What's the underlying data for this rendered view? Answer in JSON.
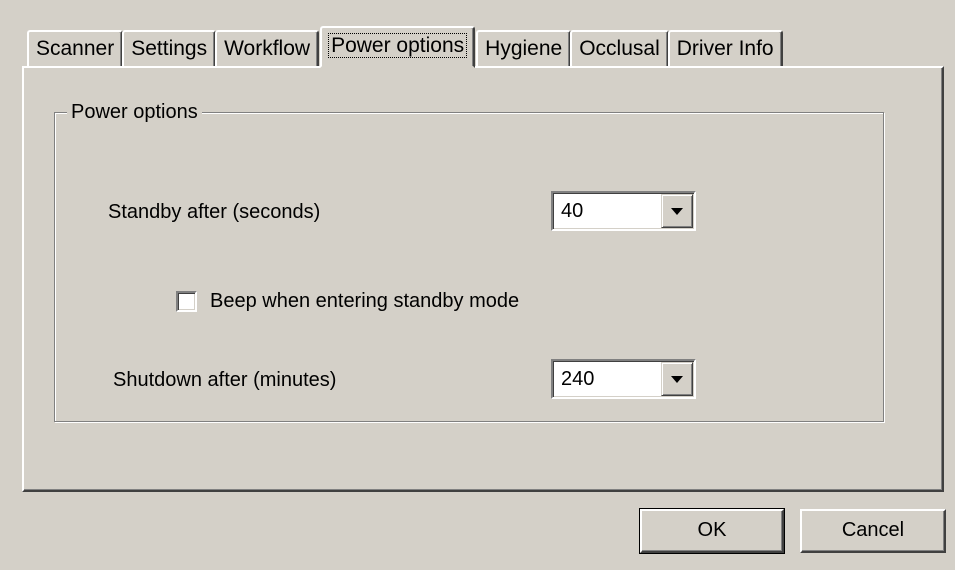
{
  "tabs": [
    {
      "label": "Scanner"
    },
    {
      "label": "Settings"
    },
    {
      "label": "Workflow"
    },
    {
      "label": "Power options"
    },
    {
      "label": "Hygiene"
    },
    {
      "label": "Occlusal"
    },
    {
      "label": "Driver Info"
    }
  ],
  "active_tab": "Power options",
  "group": {
    "title": "Power options",
    "standby": {
      "label": "Standby after (seconds)",
      "value": "40"
    },
    "beep": {
      "label": "Beep when entering standby mode",
      "checked": false
    },
    "shutdown": {
      "label": "Shutdown after (minutes)",
      "value": "240"
    }
  },
  "buttons": {
    "ok": "OK",
    "cancel": "Cancel"
  },
  "colors": {
    "dialog_face": "#d4d0c8",
    "highlight": "#ffffff",
    "shadow": "#808080",
    "dark_shadow": "#404040"
  }
}
